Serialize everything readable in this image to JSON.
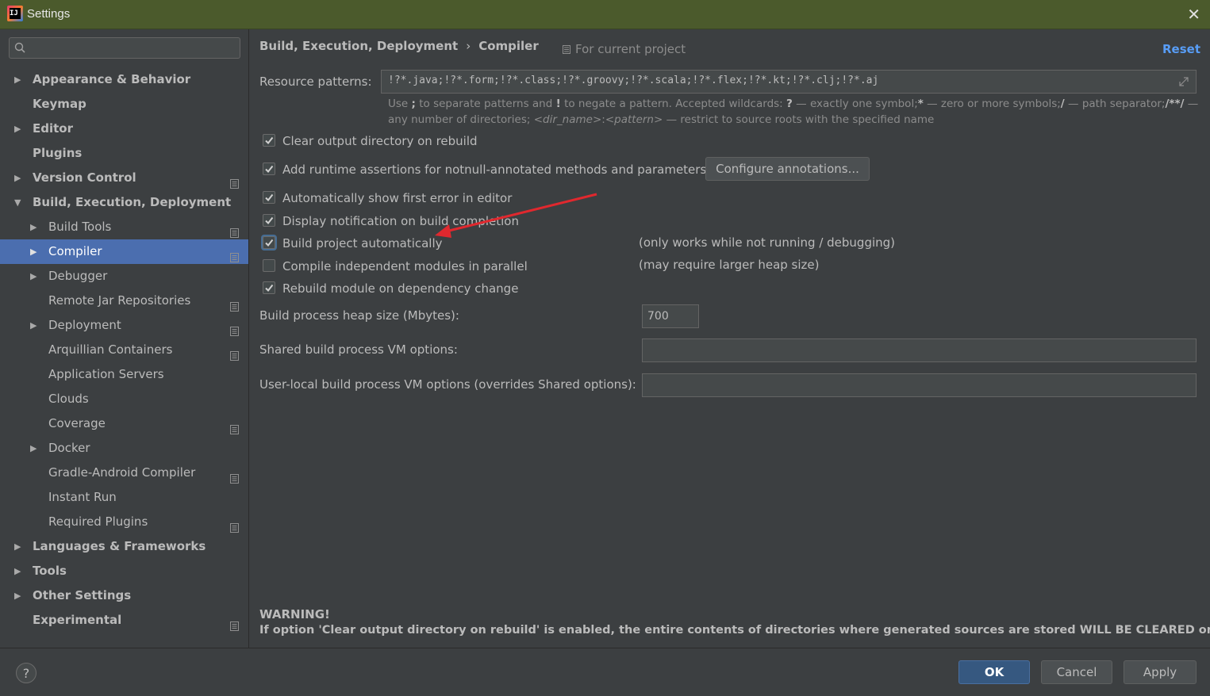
{
  "window": {
    "title": "Settings",
    "close_icon": "close-icon"
  },
  "search": {
    "placeholder": ""
  },
  "tree": [
    {
      "label": "Appearance & Behavior",
      "level": 0,
      "arrow": "▶",
      "proj": false
    },
    {
      "label": "Keymap",
      "level": 0,
      "arrow": "",
      "proj": false
    },
    {
      "label": "Editor",
      "level": 0,
      "arrow": "▶",
      "proj": false
    },
    {
      "label": "Plugins",
      "level": 0,
      "arrow": "",
      "proj": false
    },
    {
      "label": "Version Control",
      "level": 0,
      "arrow": "▶",
      "proj": true
    },
    {
      "label": "Build, Execution, Deployment",
      "level": 0,
      "arrow": "▼",
      "proj": false
    },
    {
      "label": "Build Tools",
      "level": 1,
      "arrow": "▶",
      "proj": true
    },
    {
      "label": "Compiler",
      "level": 1,
      "arrow": "▶",
      "proj": true,
      "selected": true
    },
    {
      "label": "Debugger",
      "level": 1,
      "arrow": "▶",
      "proj": false
    },
    {
      "label": "Remote Jar Repositories",
      "level": 1,
      "arrow": "",
      "proj": true
    },
    {
      "label": "Deployment",
      "level": 1,
      "arrow": "▶",
      "proj": true
    },
    {
      "label": "Arquillian Containers",
      "level": 1,
      "arrow": "",
      "proj": true
    },
    {
      "label": "Application Servers",
      "level": 1,
      "arrow": "",
      "proj": false
    },
    {
      "label": "Clouds",
      "level": 1,
      "arrow": "",
      "proj": false
    },
    {
      "label": "Coverage",
      "level": 1,
      "arrow": "",
      "proj": true
    },
    {
      "label": "Docker",
      "level": 1,
      "arrow": "▶",
      "proj": false
    },
    {
      "label": "Gradle-Android Compiler",
      "level": 1,
      "arrow": "",
      "proj": true
    },
    {
      "label": "Instant Run",
      "level": 1,
      "arrow": "",
      "proj": false
    },
    {
      "label": "Required Plugins",
      "level": 1,
      "arrow": "",
      "proj": true
    },
    {
      "label": "Languages & Frameworks",
      "level": 0,
      "arrow": "▶",
      "proj": false
    },
    {
      "label": "Tools",
      "level": 0,
      "arrow": "▶",
      "proj": false
    },
    {
      "label": "Other Settings",
      "level": 0,
      "arrow": "▶",
      "proj": false
    },
    {
      "label": "Experimental",
      "level": 0,
      "arrow": "",
      "proj": true
    }
  ],
  "header": {
    "breadcrumb_parent": "Build, Execution, Deployment",
    "breadcrumb_sep": "›",
    "breadcrumb_current": "Compiler",
    "scope_note": "For current project",
    "reset": "Reset"
  },
  "resource": {
    "label": "Resource patterns:",
    "value": "!?*.java;!?*.form;!?*.class;!?*.groovy;!?*.scala;!?*.flex;!?*.kt;!?*.clj;!?*.aj",
    "hint_1": "Use",
    "hint_2": ";",
    "hint_3": "to separate patterns and",
    "hint_4": "!",
    "hint_5": "to negate a pattern. Accepted wildcards:",
    "hint_6": "?",
    "hint_7": "— exactly one symbol;",
    "hint_8": "*",
    "hint_9": "— zero or more symbols;",
    "hint_10": "/",
    "hint_11": "— path separator;",
    "hint_12": "/**/",
    "hint_13": "— any number of directories;",
    "hint_14": "<dir_name>",
    "hint_15": ":",
    "hint_16": "<pattern>",
    "hint_17": "— restrict to source roots with the specified name"
  },
  "options": [
    {
      "label": "Clear output directory on rebuild",
      "checked": true
    },
    {
      "label": "Add runtime assertions for notnull-annotated methods and parameters",
      "checked": true
    },
    {
      "label": "Automatically show first error in editor",
      "checked": true
    },
    {
      "label": "Display notification on build completion",
      "checked": true
    },
    {
      "label": "Build project automatically",
      "checked": true
    },
    {
      "label": "Compile independent modules in parallel",
      "checked": false
    },
    {
      "label": "Rebuild module on dependency change",
      "checked": true
    }
  ],
  "configure_button": "Configure annotations...",
  "notes": {
    "build_auto": "(only works while not running / debugging)",
    "parallel": "(may require larger heap size)"
  },
  "fields": {
    "heap_label": "Build process heap size (Mbytes):",
    "heap_value": "700",
    "shared_label": "Shared build process VM options:",
    "shared_value": "",
    "local_label": "User-local build process VM options (overrides Shared options):",
    "local_value": ""
  },
  "warning": {
    "title": "WARNING!",
    "text": "If option 'Clear output directory on rebuild' is enabled, the entire contents of directories where generated sources are stored WILL BE CLEARED on rebuild."
  },
  "footer": {
    "help": "?",
    "ok": "OK",
    "cancel": "Cancel",
    "apply": "Apply"
  },
  "colors": {
    "titlebar": "#4b5a2c",
    "selection": "#4b6eaf",
    "link": "#589df6",
    "annotation_arrow": "#e0282e"
  }
}
